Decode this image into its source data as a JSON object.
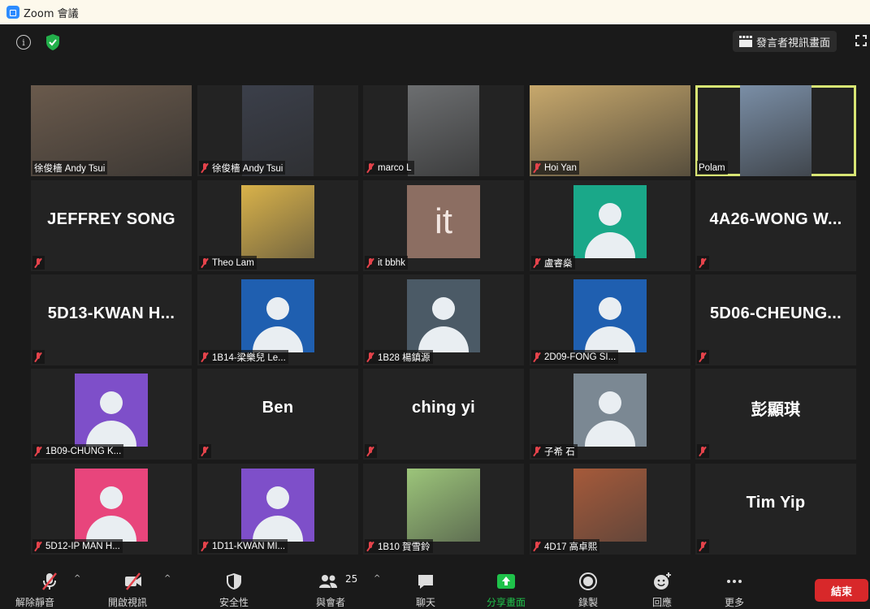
{
  "window": {
    "title": "Zoom 會議"
  },
  "topbar": {
    "speaker_view_label": "發言者視訊畫面"
  },
  "participants": [
    {
      "name": "徐俊檣 Andy Tsui",
      "type": "video",
      "muted": false,
      "bg": "#6a5a4c"
    },
    {
      "name": "徐俊檣 Andy Tsui",
      "type": "video",
      "muted": true,
      "bg": "#3b3f4a"
    },
    {
      "name": "marco L",
      "type": "video",
      "muted": true,
      "bg": "#6c6e70"
    },
    {
      "name": "Hoi Yan",
      "type": "video",
      "muted": true,
      "bg": "#c7a86c"
    },
    {
      "name": "Polam",
      "type": "video",
      "muted": false,
      "active": true,
      "bg": "#7a8ea6"
    },
    {
      "name": "JEFFREY SONG",
      "type": "text",
      "muted": true
    },
    {
      "name": "Theo Lam",
      "type": "image",
      "muted": true,
      "avatar_color": "#d9b24a"
    },
    {
      "name": "it bbhk",
      "type": "letter",
      "letter": "it",
      "muted": true,
      "avatar_color": "#8c6e62"
    },
    {
      "name": "盧睿燊",
      "type": "avatar",
      "muted": true,
      "avatar_color": "#1aa889"
    },
    {
      "name": "4A26-WONG  W...",
      "type": "text",
      "muted": true
    },
    {
      "name": "5D13-KWAN  H...",
      "type": "text",
      "muted": true
    },
    {
      "name": "1B14-梁樂兒 Le...",
      "type": "avatar",
      "muted": true,
      "avatar_color": "#1f5fb0"
    },
    {
      "name": "1B28 楊鎮源",
      "type": "avatar",
      "muted": true,
      "avatar_color": "#4b5a66"
    },
    {
      "name": "2D09-FONG SI...",
      "type": "avatar",
      "muted": true,
      "avatar_color": "#1f5fb0"
    },
    {
      "name": "5D06-CHEUNG...",
      "type": "text",
      "muted": true
    },
    {
      "name": "1B09-CHUNG K...",
      "type": "avatar",
      "muted": true,
      "avatar_color": "#7e4fc9"
    },
    {
      "name": "Ben",
      "type": "text",
      "muted": true
    },
    {
      "name": "ching yi",
      "type": "text",
      "muted": true
    },
    {
      "name": "子希 石",
      "type": "avatar",
      "muted": true,
      "avatar_color": "#7b8893"
    },
    {
      "name": "彭顯琪",
      "type": "text",
      "muted": true
    },
    {
      "name": "5D12-IP MAN H...",
      "type": "avatar",
      "muted": true,
      "avatar_color": "#e8457c"
    },
    {
      "name": "1D11-KWAN MI...",
      "type": "avatar",
      "muted": true,
      "avatar_color": "#7e4fc9"
    },
    {
      "name": "1B10 賀雪鈴",
      "type": "image",
      "muted": true,
      "avatar_color": "#9cc57a"
    },
    {
      "name": "4D17 高卓熙",
      "type": "image",
      "muted": true,
      "avatar_color": "#a65a3a"
    },
    {
      "name": "Tim Yip",
      "type": "text",
      "muted": true
    }
  ],
  "toolbar": {
    "unmute_label": "解除靜音",
    "start_video_label": "開啟視訊",
    "security_label": "安全性",
    "participants_label": "與會者",
    "participants_count": "25",
    "chat_label": "聊天",
    "share_screen_label": "分享畫面",
    "record_label": "錄製",
    "reactions_label": "回應",
    "more_label": "更多",
    "end_label": "結束"
  },
  "colors": {
    "accent_green": "#1fc24a",
    "active_border": "#d8e574",
    "end_red": "#d8282a",
    "muted_red": "#e5434b"
  }
}
